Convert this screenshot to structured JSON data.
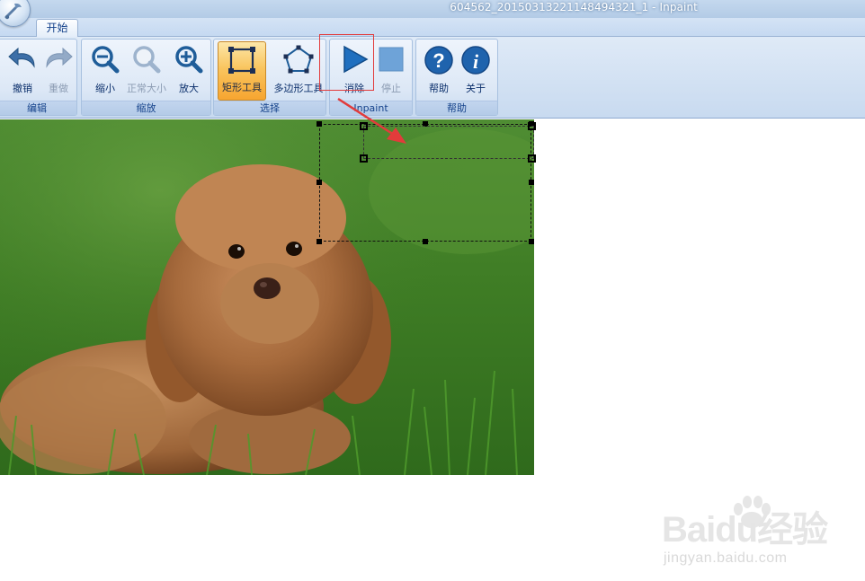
{
  "window": {
    "title": "604562_20150313221148494321_1 - Inpaint"
  },
  "tabs": [
    {
      "label": "开始"
    }
  ],
  "ribbon": {
    "groups": [
      {
        "label": "编辑",
        "buttons": [
          {
            "label": "撤销",
            "icon": "undo-icon"
          },
          {
            "label": "重做",
            "icon": "redo-icon",
            "disabled": true
          }
        ]
      },
      {
        "label": "缩放",
        "buttons": [
          {
            "label": "缩小",
            "icon": "zoom-out-icon"
          },
          {
            "label": "正常大小",
            "icon": "zoom-normal-icon",
            "disabled": true
          },
          {
            "label": "放大",
            "icon": "zoom-in-icon"
          }
        ]
      },
      {
        "label": "选择",
        "buttons": [
          {
            "label": "矩形工具",
            "icon": "rectangle-tool-icon",
            "active": true
          },
          {
            "label": "多边形工具",
            "icon": "polygon-tool-icon"
          }
        ]
      },
      {
        "label": "Inpaint",
        "buttons": [
          {
            "label": "消除",
            "icon": "play-icon"
          },
          {
            "label": "停止",
            "icon": "stop-icon",
            "disabled": true
          }
        ]
      },
      {
        "label": "帮助",
        "buttons": [
          {
            "label": "帮助",
            "icon": "help-icon"
          },
          {
            "label": "关于",
            "icon": "info-icon"
          }
        ]
      }
    ]
  },
  "watermark": {
    "brand": "Baidu经验",
    "url": "jingyan.baidu.com"
  },
  "colors": {
    "accent_red": "#e23b3b",
    "ribbon_blue": "#15428b",
    "active_orange": "#f9c55f"
  }
}
